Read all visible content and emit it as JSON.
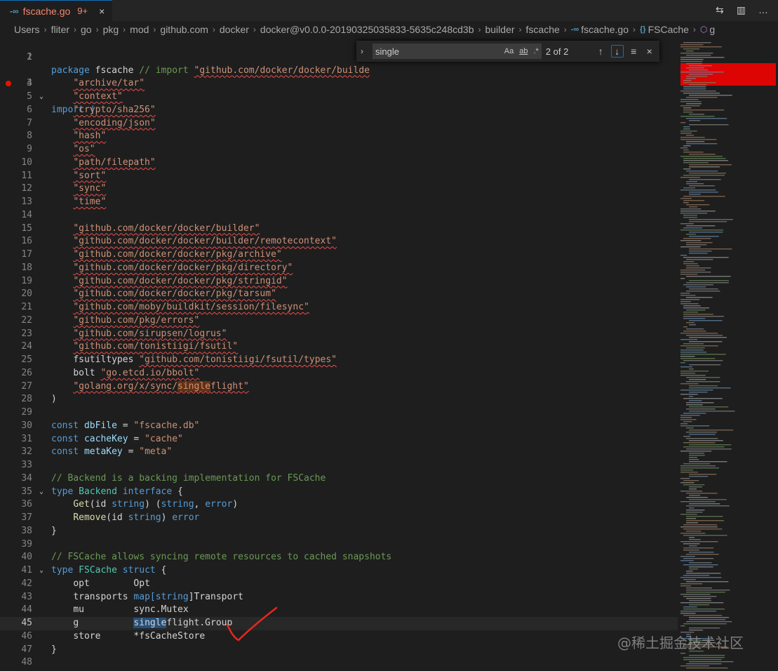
{
  "tab": {
    "icon": "go-file-icon",
    "filename": "fscache.go",
    "badge": "9+",
    "close": "×"
  },
  "tab_actions": [
    {
      "name": "open-changes-icon",
      "glyph": "⇆"
    },
    {
      "name": "split-editor-icon",
      "glyph": "▥"
    },
    {
      "name": "more-actions-icon",
      "glyph": "…"
    }
  ],
  "breadcrumbs": [
    "Users",
    "fliter",
    "go",
    "pkg",
    "mod",
    "github.com",
    "docker",
    "docker@v0.0.0-20190325035833-5635c248cd3b",
    "builder",
    "fscache",
    "fscache.go",
    "FSCache",
    "g"
  ],
  "find_widget": {
    "query": "single",
    "match_case": "Aa",
    "whole_word": "ab",
    "regex": ".*",
    "result_count": "2 of 2",
    "prev": "↑",
    "next": "↓",
    "in_selection": "≡",
    "close": "×"
  },
  "code": {
    "line_numbers": [
      "1",
      "2",
      "3",
      "4",
      "5",
      "6",
      "7",
      "8",
      "9",
      "10",
      "11",
      "12",
      "13",
      "14",
      "15",
      "16",
      "17",
      "18",
      "19",
      "20",
      "21",
      "22",
      "23",
      "24",
      "25",
      "26",
      "27",
      "28",
      "29",
      "30",
      "31",
      "32",
      "33",
      "34",
      "35",
      "36",
      "37",
      "38",
      "39",
      "40",
      "41",
      "42",
      "43",
      "44",
      "45",
      "46",
      "47",
      "48"
    ],
    "line1": {
      "kw": "package",
      "name": "fscache",
      "comment": "// import ",
      "import_path": "\"github.com/docker/docker/builde"
    },
    "imports_kw": "import (",
    "stdlib_imports": [
      "\"archive/tar\"",
      "\"context\"",
      "\"crypto/sha256\"",
      "\"encoding/json\"",
      "\"hash\"",
      "\"os\"",
      "\"path/filepath\"",
      "\"sort\"",
      "\"sync\"",
      "\"time\""
    ],
    "ext_imports": [
      "\"github.com/docker/docker/builder\"",
      "\"github.com/docker/docker/builder/remotecontext\"",
      "\"github.com/docker/docker/pkg/archive\"",
      "\"github.com/docker/docker/pkg/directory\"",
      "\"github.com/docker/docker/pkg/stringid\"",
      "\"github.com/docker/docker/pkg/tarsum\"",
      "\"github.com/moby/buildkit/session/filesync\"",
      "\"github.com/pkg/errors\"",
      "\"github.com/sirupsen/logrus\"",
      "\"github.com/tonistiigi/fsutil\""
    ],
    "alias_imports": [
      {
        "alias": "fsutiltypes",
        "path": "\"github.com/tonistiigi/fsutil/types\""
      },
      {
        "alias": "bolt",
        "path": "\"go.etcd.io/bbolt\""
      }
    ],
    "singleflight_import": {
      "pre": "\"golang.org/x/sync/",
      "match": "single",
      "post": "flight\""
    },
    "close_paren": ")",
    "consts": [
      {
        "kw": "const",
        "name": "dbFile",
        "eq": " = ",
        "val": "\"fscache.db\""
      },
      {
        "kw": "const",
        "name": "cacheKey",
        "eq": " = ",
        "val": "\"cache\""
      },
      {
        "kw": "const",
        "name": "metaKey",
        "eq": " = ",
        "val": "\"meta\""
      }
    ],
    "backend_comment": "// Backend is a backing implementation for FSCache",
    "backend_decl": {
      "kw": "type",
      "name": "Backend",
      "kw2": "interface",
      "brace": " {"
    },
    "backend_methods": [
      {
        "fn": "Get",
        "sig_open": "(id ",
        "arg_type": "string",
        "sig_close": ") (",
        "ret1": "string",
        "comma": ", ",
        "ret2": "error",
        "end": ")"
      },
      {
        "fn": "Remove",
        "sig_open": "(id ",
        "arg_type": "string",
        "sig_close": ") ",
        "ret1": "error"
      }
    ],
    "close_brace": "}",
    "fscache_comment": "// FSCache allows syncing remote resources to cached snapshots",
    "fscache_decl": {
      "kw": "type",
      "name": "FSCache",
      "kw2": "struct",
      "brace": " {"
    },
    "fields": [
      {
        "name": "opt",
        "type": "Opt"
      },
      {
        "name": "transports",
        "type_kw": "map[",
        "type_key": "string",
        "type_rest": "]Transport"
      },
      {
        "name": "mu",
        "type": "sync.Mutex"
      },
      {
        "name": "g",
        "match": "single",
        "type_rest": "flight.Group"
      },
      {
        "name": "store",
        "type": "*fsCacheStore"
      }
    ]
  },
  "watermark": "@稀土掘金技术社区"
}
